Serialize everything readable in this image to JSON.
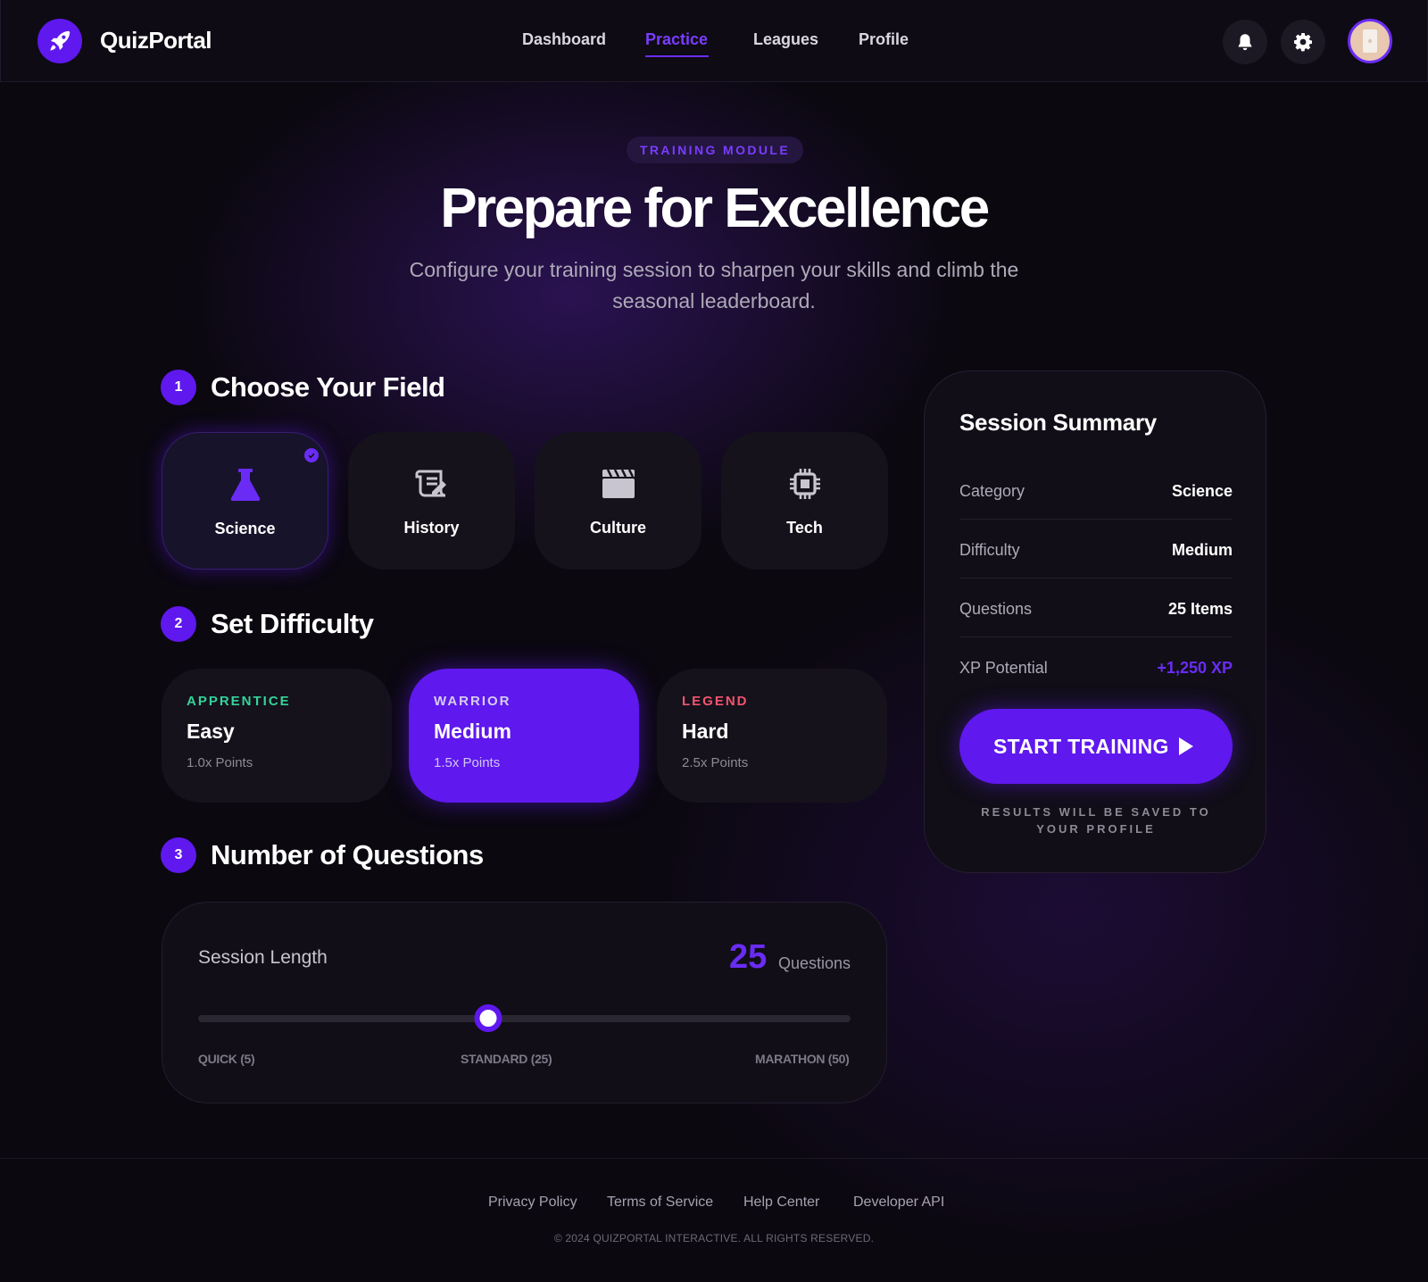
{
  "header": {
    "brand": "QuizPortal",
    "nav": [
      {
        "label": "Dashboard",
        "active": false
      },
      {
        "label": "Practice",
        "active": true
      },
      {
        "label": "Leagues",
        "active": false
      },
      {
        "label": "Profile",
        "active": false
      }
    ],
    "icons": [
      "rocket-icon",
      "bell-icon",
      "gear-icon",
      "avatar"
    ]
  },
  "hero": {
    "badge": "TRAINING MODULE",
    "title": "Prepare for Excellence",
    "subtitle": "Configure your training session to sharpen your skills and climb the seasonal leaderboard."
  },
  "steps": [
    {
      "number": "1",
      "title": "Choose Your Field"
    },
    {
      "number": "2",
      "title": "Set Difficulty"
    },
    {
      "number": "3",
      "title": "Number of Questions"
    }
  ],
  "fields": [
    {
      "label": "Science",
      "icon": "flask-icon",
      "selected": true
    },
    {
      "label": "History",
      "icon": "scroll-icon",
      "selected": false
    },
    {
      "label": "Culture",
      "icon": "clapperboard-icon",
      "selected": false
    },
    {
      "label": "Tech",
      "icon": "chip-icon",
      "selected": false
    }
  ],
  "difficulties": [
    {
      "tag": "APPRENTICE",
      "name": "Easy",
      "points": "1.0x Points",
      "color": "#34d399",
      "selected": false
    },
    {
      "tag": "WARRIOR",
      "name": "Medium",
      "points": "1.5x Points",
      "color": "#d6cdf0",
      "selected": true
    },
    {
      "tag": "LEGEND",
      "name": "Hard",
      "points": "2.5x Points",
      "color": "#f2546e",
      "selected": false
    }
  ],
  "session_length": {
    "label": "Session Length",
    "value": "25",
    "unit": "Questions",
    "min": 5,
    "max": 50,
    "current": 25,
    "ticks": [
      "QUICK (5)",
      "STANDARD (25)",
      "MARATHON (50)"
    ]
  },
  "summary": {
    "title": "Session Summary",
    "rows": [
      {
        "key": "Category",
        "value": "Science"
      },
      {
        "key": "Difficulty",
        "value": "Medium"
      },
      {
        "key": "Questions",
        "value": "25 Items"
      },
      {
        "key": "XP Potential",
        "value": "+1,250 XP"
      }
    ],
    "button": "START TRAINING",
    "note": "RESULTS WILL BE SAVED TO YOUR PROFILE"
  },
  "footer": {
    "links": [
      "Privacy Policy",
      "Terms of Service",
      "Help Center",
      "Developer API"
    ],
    "copyright": "© 2024 QUIZPORTAL INTERACTIVE. ALL RIGHTS RESERVED."
  },
  "colors": {
    "accent": "#5f18ee",
    "accent_text": "#6a2cf5",
    "background": "#0b0810",
    "card": "#15121c"
  }
}
